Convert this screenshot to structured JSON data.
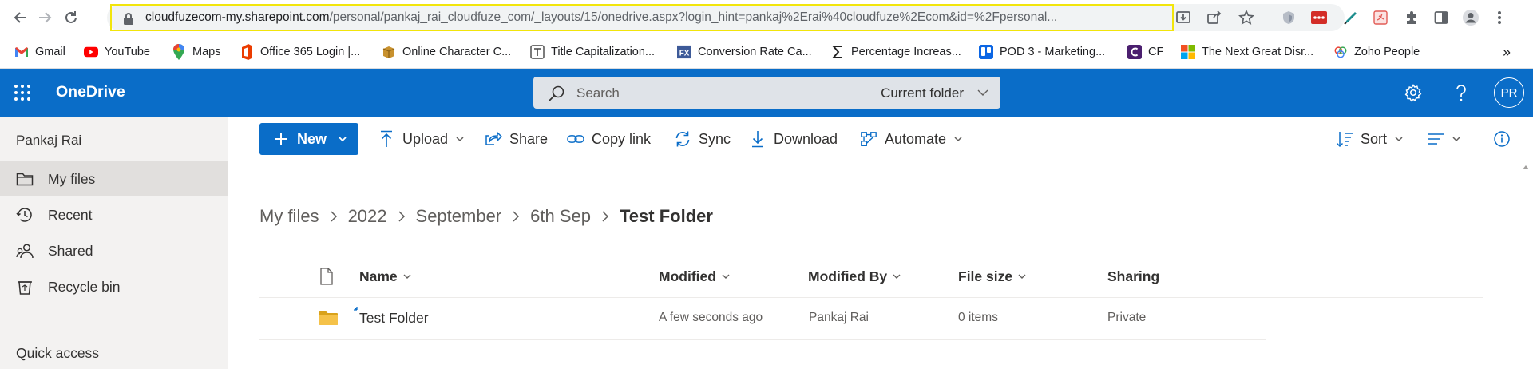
{
  "browser": {
    "url_domain": "cloudfuzecom-my.sharepoint.com",
    "url_path": "/personal/pankaj_rai_cloudfuze_com/_layouts/15/onedrive.aspx?login_hint=pankaj%2Erai%40cloudfuze%2Ecom&id=%2Fpersonal...",
    "bookmarks": [
      {
        "label": "Gmail",
        "icon": "gmail-icon"
      },
      {
        "label": "YouTube",
        "icon": "youtube-icon"
      },
      {
        "label": "Maps",
        "icon": "maps-icon"
      },
      {
        "label": "Office 365 Login |...",
        "icon": "office-icon"
      },
      {
        "label": "Online Character C...",
        "icon": "box-icon"
      },
      {
        "label": "Title Capitalization...",
        "icon": "title-icon"
      },
      {
        "label": "Conversion Rate Ca...",
        "icon": "fx-icon"
      },
      {
        "label": "Percentage Increas...",
        "icon": "sigma-icon"
      },
      {
        "label": "POD 3 - Marketing...",
        "icon": "trello-icon"
      },
      {
        "label": "CF",
        "icon": "cf-icon"
      },
      {
        "label": "The Next Great Disr...",
        "icon": "microsoft-icon"
      },
      {
        "label": "Zoho People",
        "icon": "zoho-icon"
      }
    ],
    "overflow": "»"
  },
  "suite": {
    "app_name": "OneDrive",
    "search_placeholder": "Search",
    "search_scope": "Current folder",
    "avatar_initials": "PR"
  },
  "leftnav": {
    "user_name": "Pankaj Rai",
    "items": [
      {
        "label": "My files",
        "active": true
      },
      {
        "label": "Recent"
      },
      {
        "label": "Shared"
      },
      {
        "label": "Recycle bin"
      }
    ],
    "quick_access": "Quick access"
  },
  "commandbar": {
    "new": "New",
    "upload": "Upload",
    "share": "Share",
    "copy_link": "Copy link",
    "sync": "Sync",
    "download": "Download",
    "automate": "Automate",
    "sort": "Sort"
  },
  "breadcrumb": [
    "My files",
    "2022",
    "September",
    "6th Sep",
    "Test Folder"
  ],
  "table": {
    "columns": {
      "name": "Name",
      "modified": "Modified",
      "modified_by": "Modified By",
      "file_size": "File size",
      "sharing": "Sharing"
    },
    "rows": [
      {
        "name": "Test Folder",
        "modified": "A few seconds ago",
        "modified_by": "Pankaj Rai",
        "file_size": "0 items",
        "sharing": "Private"
      }
    ]
  },
  "colors": {
    "brand": "#0A6DC8",
    "url_highlight": "#F2E50B",
    "folder": "#F0B429"
  }
}
